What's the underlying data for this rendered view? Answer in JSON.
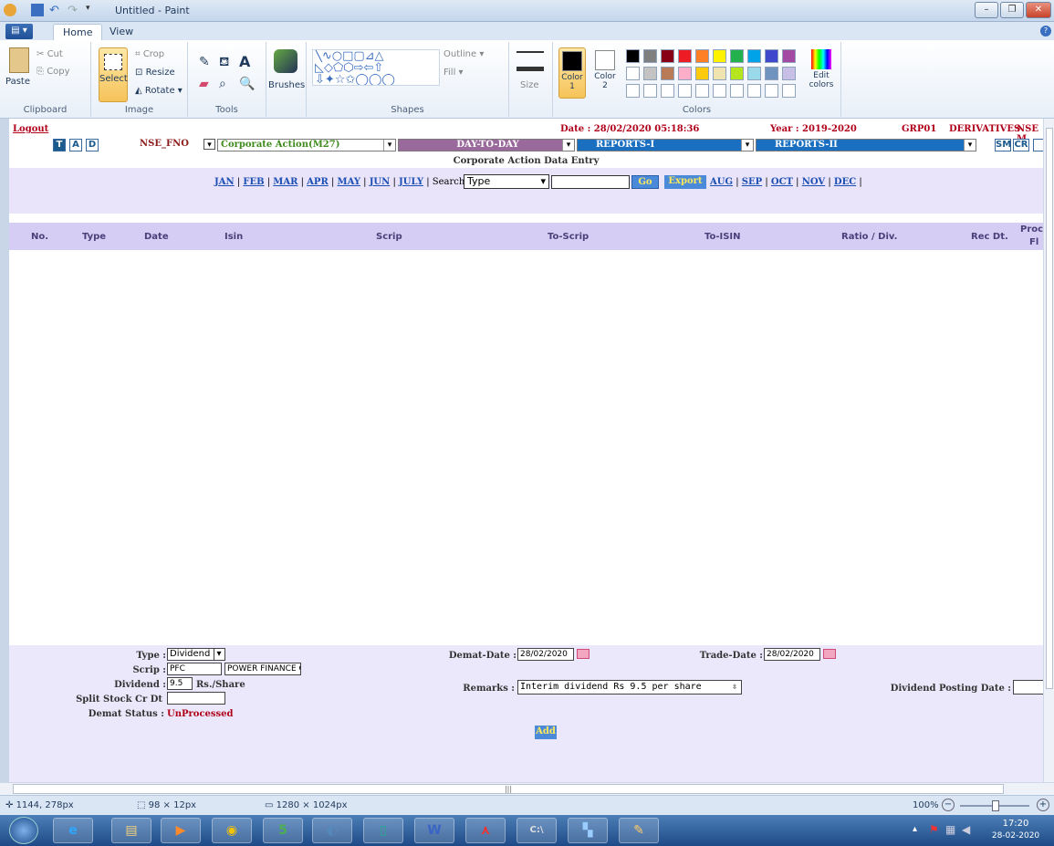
{
  "window": {
    "title": "Untitled - Paint"
  },
  "menu": {
    "file": "▤ ▾",
    "tabs": [
      "Home",
      "View"
    ]
  },
  "ribbon": {
    "clipboard": {
      "paste": "Paste",
      "cut": "Cut",
      "copy": "Copy",
      "label": "Clipboard"
    },
    "image": {
      "select": "Select",
      "crop": "Crop",
      "resize": "Resize",
      "rotate": "Rotate ▾",
      "label": "Image"
    },
    "tools": {
      "label": "Tools"
    },
    "brushes": {
      "label": "Brushes"
    },
    "shapes": {
      "outline": "Outline ▾",
      "fill": "Fill ▾",
      "label": "Shapes"
    },
    "size": {
      "label": "Size"
    },
    "colors": {
      "color1": "Color 1",
      "color2": "Color 2",
      "edit": "Edit colors",
      "label": "Colors"
    }
  },
  "app": {
    "logout": "Logout",
    "date": "Date : 28/02/2020 05:18:36",
    "year": "Year : 2019-2020",
    "group": "GRP01",
    "segment": "DERIVATIVES",
    "exchange": "NSE M",
    "tad": [
      "T",
      "A",
      "D"
    ],
    "exchange_select": "NSE_FNO",
    "action_select": "Corporate Action(M27)",
    "day_to_day": "DAY-TO-DAY",
    "reports1": "REPORTS-I",
    "reports2": "REPORTS-II",
    "sm": "SM",
    "cr": "CR",
    "page_title": "Corporate Action Data Entry",
    "months_a": [
      "JAN",
      "FEB",
      "MAR",
      "APR",
      "MAY",
      "JUN",
      "JULY"
    ],
    "search_label": "Search:",
    "search_select": "Type",
    "go": "Go",
    "export": "Export",
    "months_b": [
      "AUG",
      "SEP",
      "OCT",
      "NOV",
      "DEC"
    ],
    "columns": [
      "No.",
      "Type",
      "Date",
      "Isin",
      "Scrip",
      "To-Scrip",
      "To-ISIN",
      "Ratio / Div.",
      "Rec Dt.",
      "Proc",
      "Fl"
    ],
    "form": {
      "type_label": "Type :",
      "type_value": "Dividend",
      "scrip_label": "Scrip :",
      "scrip_code": "PFC",
      "scrip_name": "POWER FINANCE C",
      "dividend_label": "Dividend :",
      "dividend_value": "9.5",
      "dividend_unit": "Rs./Share",
      "split_label": "Split Stock Cr Dt",
      "demat_status_label": "Demat Status :",
      "demat_status_value": "UnProcessed",
      "demat_date_label": "Demat-Date :",
      "demat_date_value": "28/02/2020",
      "trade_date_label": "Trade-Date :",
      "trade_date_value": "28/02/2020",
      "remarks_label": "Remarks :",
      "remarks_value": "Interim dividend Rs 9.5 per share",
      "posting_label": "Dividend Posting Date :",
      "add": "Add"
    }
  },
  "status": {
    "cursor": "1144, 278px",
    "selection": "98 × 12px",
    "canvas": "1280 × 1024px",
    "zoom": "100%"
  },
  "taskbar": {
    "time": "17:20",
    "date": "28-02-2020"
  },
  "palette": [
    "#000000",
    "#7f7f7f",
    "#880015",
    "#ed1c24",
    "#ff7f27",
    "#fff200",
    "#22b14c",
    "#00a2e8",
    "#3f48cc",
    "#a349a4",
    "#ffffff",
    "#c3c3c3",
    "#b97a57",
    "#ffaec9",
    "#ffc90e",
    "#efe4b0",
    "#b5e61d",
    "#99d9ea",
    "#7092be",
    "#c8bfe7"
  ]
}
